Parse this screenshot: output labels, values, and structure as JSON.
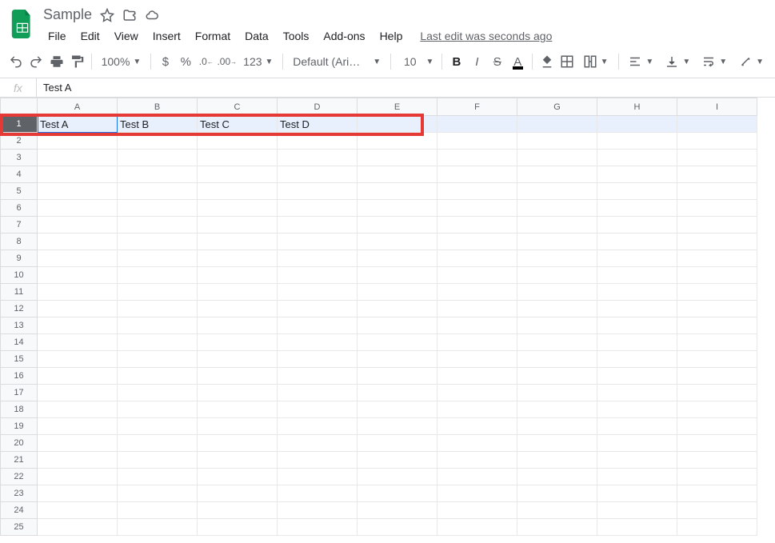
{
  "doc": {
    "title": "Sample"
  },
  "menu": {
    "items": [
      "File",
      "Edit",
      "View",
      "Insert",
      "Format",
      "Data",
      "Tools",
      "Add-ons",
      "Help"
    ],
    "last_edit": "Last edit was seconds ago"
  },
  "toolbar": {
    "zoom": "100%",
    "number_format": "123",
    "font": "Default (Ari…",
    "font_size": "10",
    "bold": "B",
    "italic": "I",
    "strike": "S",
    "text_color_letter": "A"
  },
  "formula_bar": {
    "fx": "fx",
    "value": "Test A"
  },
  "grid": {
    "columns": [
      "A",
      "B",
      "C",
      "D",
      "E",
      "F",
      "G",
      "H",
      "I"
    ],
    "rows": [
      1,
      2,
      3,
      4,
      5,
      6,
      7,
      8,
      9,
      10,
      11,
      12,
      13,
      14,
      15,
      16,
      17,
      18,
      19,
      20,
      21,
      22,
      23,
      24,
      25
    ],
    "data": {
      "1": {
        "A": "Test A",
        "B": "Test B",
        "C": "Test C",
        "D": "Test D"
      }
    },
    "selected_row": 1,
    "active_cell": "A1"
  }
}
